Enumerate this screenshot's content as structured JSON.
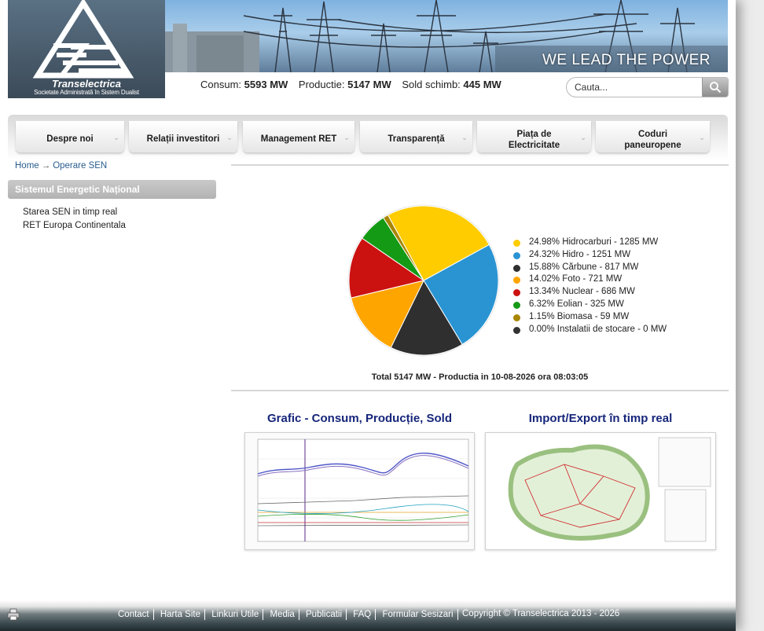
{
  "header": {
    "logo_name": "Transelectrica",
    "logo_sub": "Societate Administrată în Sistem Dualist",
    "slogan": "WE LEAD THE POWER"
  },
  "stats": {
    "consum_label": "Consum:",
    "consum_value": "5593 MW",
    "productie_label": "Productie:",
    "productie_value": "5147 MW",
    "sold_label": "Sold schimb:",
    "sold_value": "445 MW"
  },
  "search": {
    "placeholder": "Cauta..."
  },
  "nav": [
    {
      "label": "Despre noi"
    },
    {
      "label": "Relații investitori"
    },
    {
      "label": "Management RET"
    },
    {
      "label": "Transparență"
    },
    {
      "label_line1": "Piața de",
      "label_line2": "Electricitate"
    },
    {
      "label_line1": "Coduri",
      "label_line2": "paneuropene"
    }
  ],
  "breadcrumb": {
    "home": "Home",
    "current": "Operare SEN"
  },
  "sidebar": {
    "title": "Sistemul Energetic Național",
    "links": [
      "Starea SEN in timp real",
      "RET Europa Continentala"
    ]
  },
  "chart_data": {
    "type": "pie",
    "title": "Total 5147 MW - Productia in 10-08-2026 ora 08:03:05",
    "legend_position": "right",
    "slices": [
      {
        "label": "24.98% Hidrocarburi - 1285 MW",
        "name": "Hidrocarburi",
        "percent": 24.98,
        "value": 1285,
        "color": "#ffcc00"
      },
      {
        "label": "24.32% Hidro - 1251 MW",
        "name": "Hidro",
        "percent": 24.32,
        "value": 1251,
        "color": "#2a94d3"
      },
      {
        "label": "15.88% Cărbune - 817 MW",
        "name": "Cărbune",
        "percent": 15.88,
        "value": 817,
        "color": "#2f2f2f"
      },
      {
        "label": "14.02% Foto - 721 MW",
        "name": "Foto",
        "percent": 14.02,
        "value": 721,
        "color": "#ffa500"
      },
      {
        "label": "13.34% Nuclear - 686 MW",
        "name": "Nuclear",
        "percent": 13.34,
        "value": 686,
        "color": "#cc1111"
      },
      {
        "label": "6.32% Eolian - 325 MW",
        "name": "Eolian",
        "percent": 6.32,
        "value": 325,
        "color": "#159a15"
      },
      {
        "label": "1.15% Biomasa - 59 MW",
        "name": "Biomasa",
        "percent": 1.15,
        "value": 59,
        "color": "#a88600"
      },
      {
        "label": "0.00% Instalatii de stocare - 0 MW",
        "name": "Instalatii de stocare",
        "percent": 0.0,
        "value": 0,
        "color": "#333333"
      }
    ]
  },
  "sections": {
    "grafic_title": "Grafic - Consum, Producție, Sold",
    "import_title": "Import/Export în timp real"
  },
  "footer": {
    "links": [
      "Contact",
      "Harta Site",
      "Linkuri Utile",
      "Media",
      "Publicatii",
      "FAQ",
      "Formular Sesizari"
    ],
    "copyright": "Copyright © Transelectrica 2013 - 2026"
  }
}
